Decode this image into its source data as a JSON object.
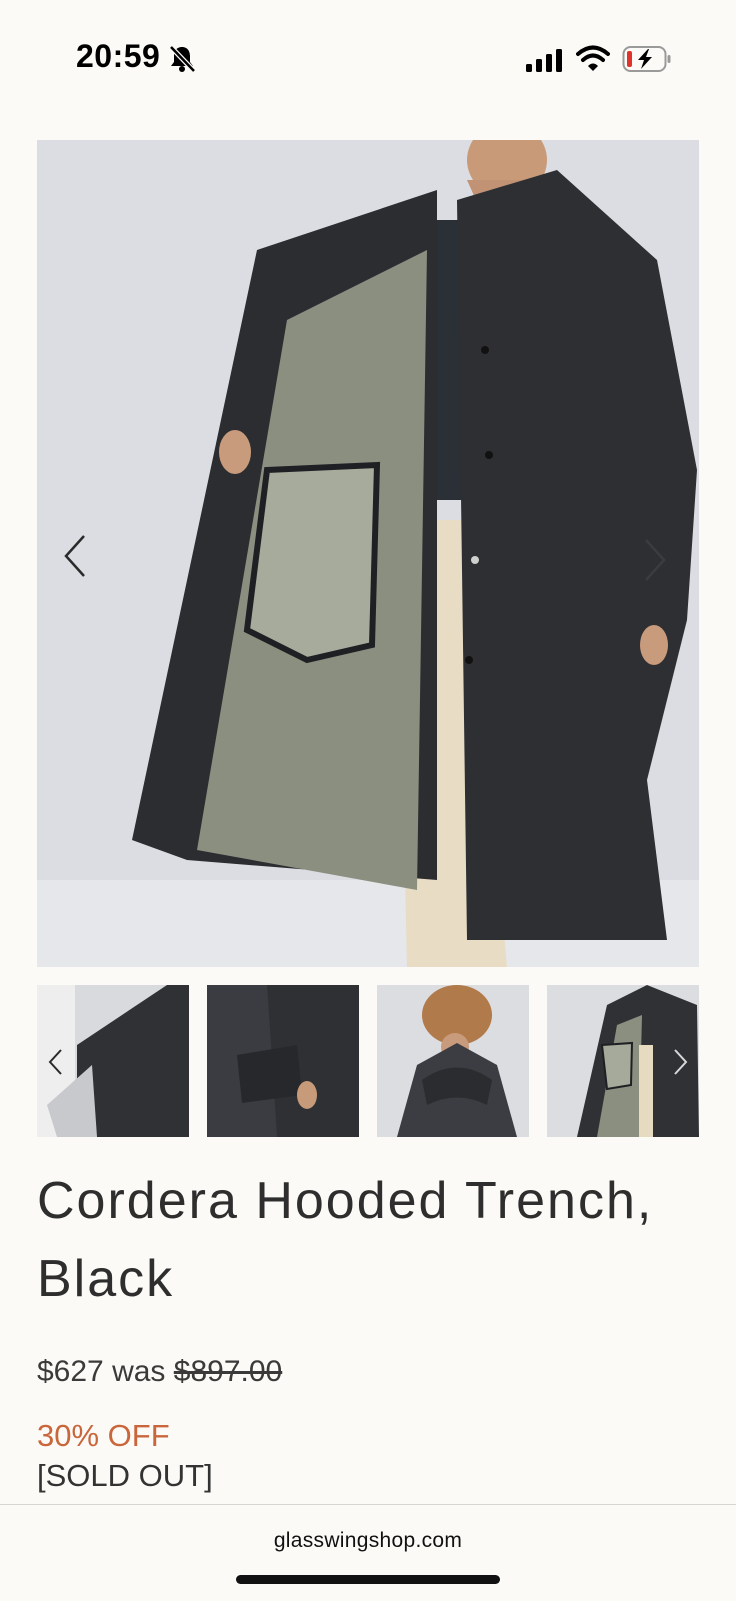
{
  "status_bar": {
    "time": "20:59",
    "icons": [
      "bell-slash-icon",
      "signal-icon",
      "wifi-icon",
      "battery-charging-icon"
    ]
  },
  "gallery": {
    "hero_alt": "Woman wearing open black hooded trench coat with khaki lining",
    "thumbnails": [
      "Trench coat sleeve detail",
      "Trench coat pocket detail",
      "Trench coat back with hood",
      "Trench coat open front"
    ]
  },
  "product": {
    "title": "Cordera Hooded Trench, Black",
    "price_current": "$627",
    "price_was_label": " was ",
    "price_old": "$897.00",
    "discount": "30% OFF",
    "availability": "[SOLD OUT]"
  },
  "browser": {
    "url": "glasswingshop.com"
  },
  "colors": {
    "background": "#fcfaf6",
    "discount": "#c9663b",
    "text": "#333333"
  }
}
